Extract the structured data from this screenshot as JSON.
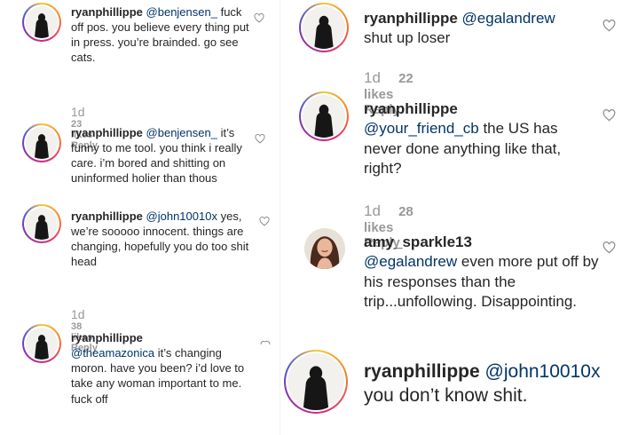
{
  "comments": [
    {
      "username": "ryanphillippe",
      "mention": "@benjensen_",
      "text": "fuck off pos. you believe every thing put in press. you’re brainded. go see cats.",
      "time": "1d",
      "likes": "23 likes",
      "reply": "Reply"
    },
    {
      "username": "ryanphillippe",
      "mention": "@benjensen_",
      "text": "it’s funny to me tool. you think i really care. i’m bored and shitting on uninformed holier than thous"
    },
    {
      "username": "ryanphillippe",
      "mention": "@john10010x",
      "text": "yes, we’re sooooo innocent. things are changing, hopefully you do too shit head",
      "time": "1d",
      "likes": "38 likes",
      "reply": "Reply"
    },
    {
      "username": "ryanphillippe",
      "mention": "@theamazonica",
      "text": "it’s changing moron. have you been? i’d love to take any woman important to me. fuck off"
    },
    {
      "username": "ryanphillippe",
      "mention": "@egalandrew",
      "text": "shut up loser",
      "time": "1d",
      "likes": "22 likes",
      "reply": "Reply"
    },
    {
      "username": "ryanphillippe",
      "mention": "@your_friend_cb",
      "text": "the US has never done anything like that, right?",
      "time": "1d",
      "likes": "28 likes",
      "reply": "Reply"
    },
    {
      "username": "amy_sparkle13",
      "mention": "@egalandrew",
      "text": "even more put off by his responses than the trip...unfollowing. Disappointing."
    },
    {
      "username": "ryanphillippe",
      "mention": "@john10010x",
      "text": "you don’t know shit."
    }
  ],
  "icons": {
    "like": "heart-outline-icon",
    "avatar": "profile-silhouette-icon"
  },
  "colors": {
    "mention": "#003569",
    "meta": "#999999",
    "text": "#262626"
  }
}
